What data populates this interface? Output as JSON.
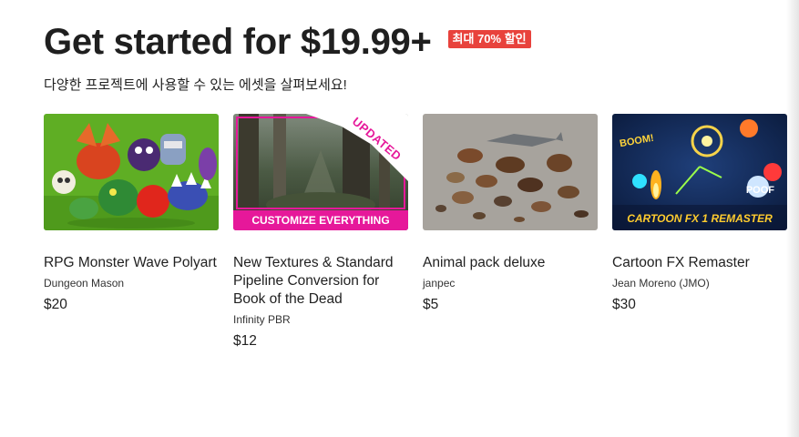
{
  "header": {
    "title": "Get started for $19.99+",
    "badge": "최대 70% 할인",
    "subtitle": "다양한 프로젝트에 사용할 수 있는 에셋을 살펴보세요!"
  },
  "cards": [
    {
      "title": "RPG Monster Wave Polyart",
      "publisher": "Dungeon Mason",
      "price": "$20"
    },
    {
      "title": "New Textures & Standard Pipeline Conversion for Book of the Dead",
      "publisher": "Infinity PBR",
      "price": "$12",
      "overlay_ribbon": "UPDATED",
      "overlay_caption": "CUSTOMIZE EVERYTHING"
    },
    {
      "title": "Animal pack deluxe",
      "publisher": "janpec",
      "price": "$5"
    },
    {
      "title": "Cartoon FX Remaster",
      "publisher": "Jean Moreno (JMO)",
      "price": "$30",
      "overlay_top": "BOOM!",
      "overlay_poof": "POOF",
      "overlay_logo": "CARTOON FX 1 REMASTER"
    }
  ],
  "colors": {
    "badge": "#e8423c",
    "magenta": "#e6189a",
    "green_bg": "#5fae24",
    "animal_bg": "#a7a39d",
    "fx_bg": "#0b1b3d"
  }
}
